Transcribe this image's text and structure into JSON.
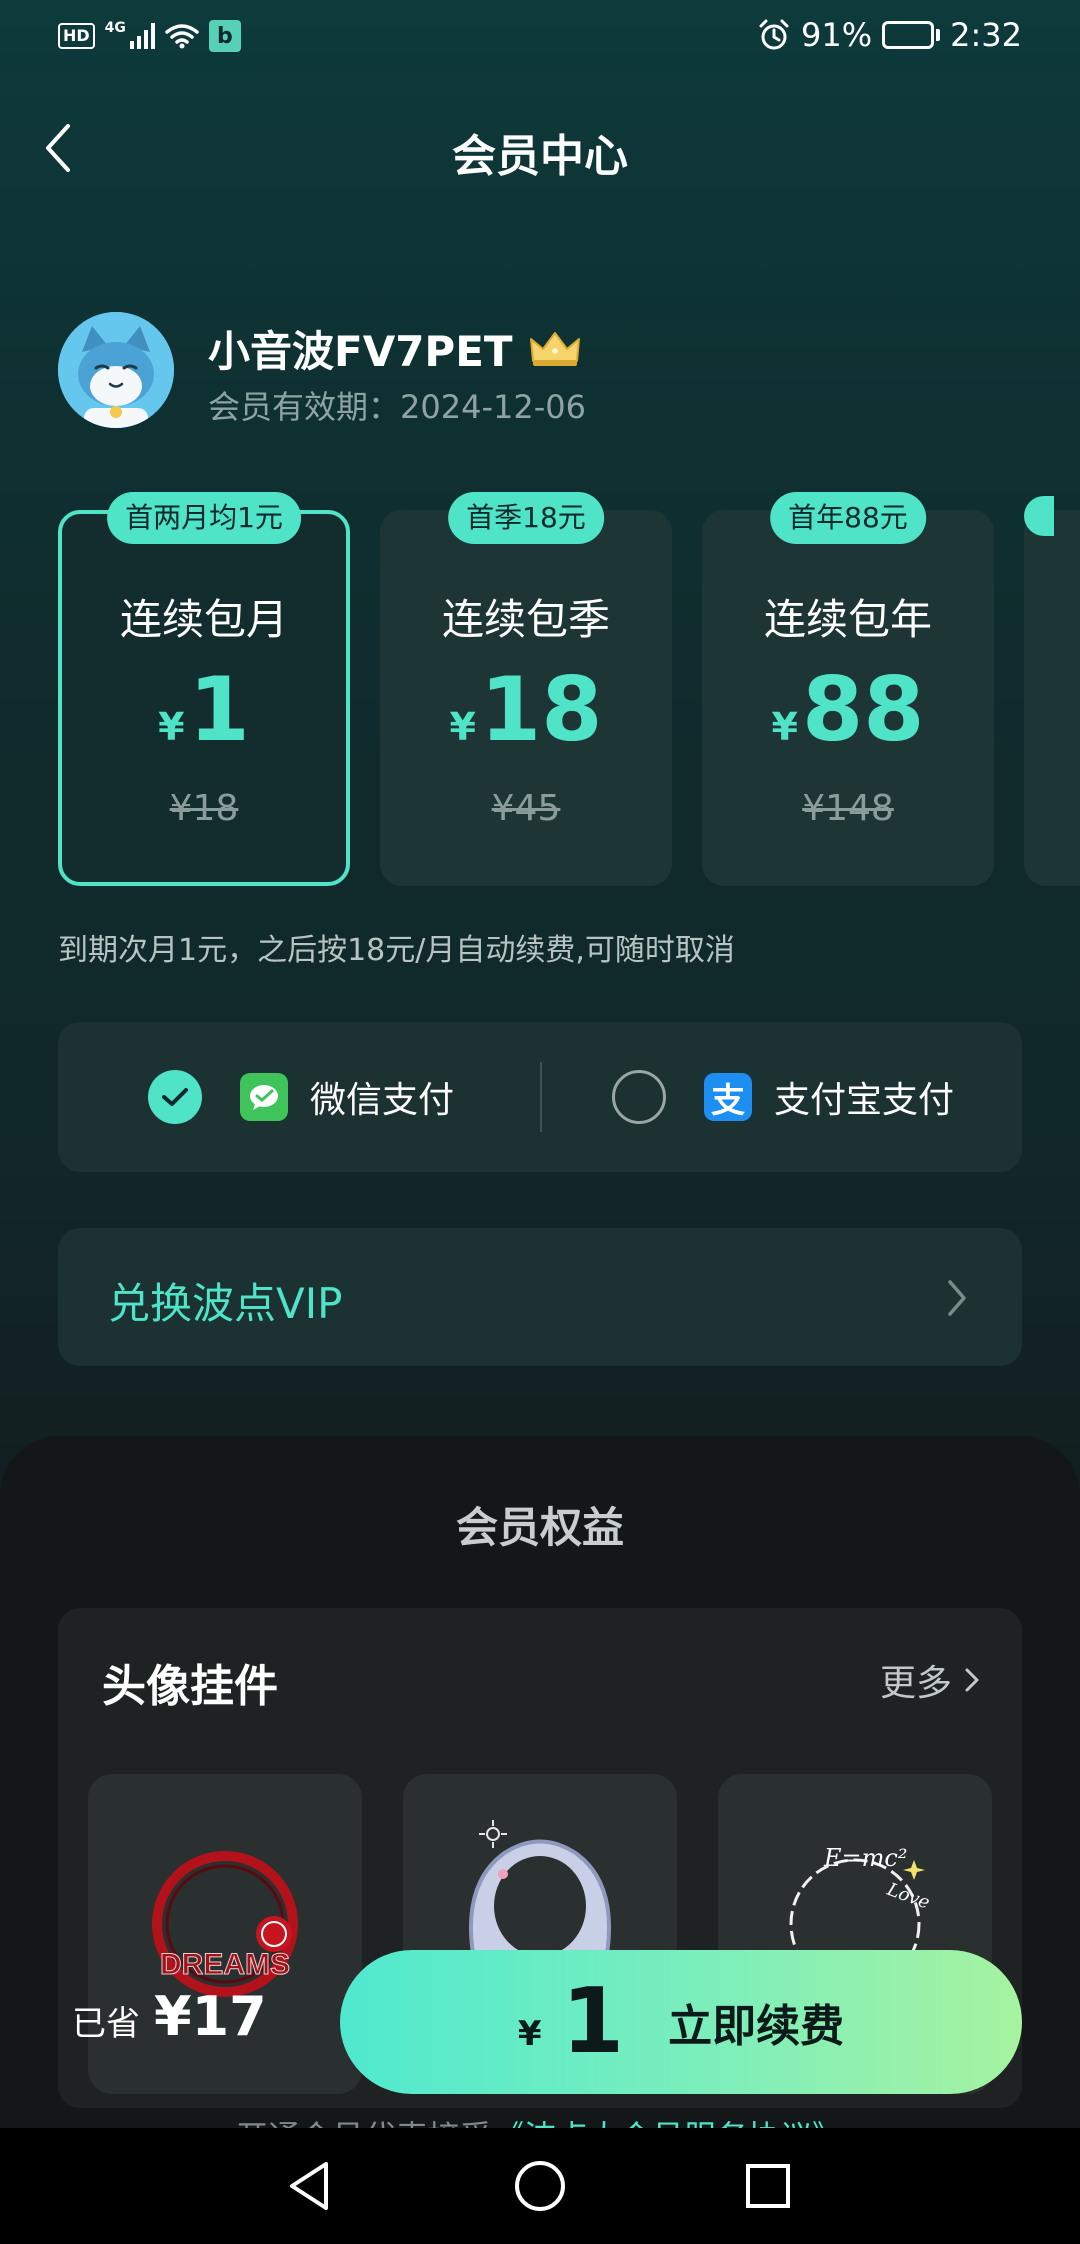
{
  "status_bar": {
    "hd": "HD",
    "network": "4G",
    "app_badge": "b",
    "battery": "91%",
    "time": "2:32"
  },
  "header": {
    "title": "会员中心"
  },
  "user": {
    "name": "小音波FV7PET",
    "expiry": "会员有效期：2024-12-06"
  },
  "plans": [
    {
      "tag": "首两月均1元",
      "name": "连续包月",
      "currency": "¥",
      "price": "1",
      "original": "¥18",
      "selected": true
    },
    {
      "tag": "首季18元",
      "name": "连续包季",
      "currency": "¥",
      "price": "18",
      "original": "¥45",
      "selected": false
    },
    {
      "tag": "首年88元",
      "name": "连续包年",
      "currency": "¥",
      "price": "88",
      "original": "¥148",
      "selected": false
    }
  ],
  "renew_note": "到期次月1元，之后按18元/月自动续费,可随时取消",
  "payment": {
    "wechat_label": "微信支付",
    "alipay_label": "支付宝支付",
    "alipay_icon_char": "支",
    "selected": "wechat"
  },
  "redeem": {
    "label": "兑换波点VIP"
  },
  "benefits": {
    "title": "会员权益",
    "section_title": "头像挂件",
    "more_label": "更多",
    "frame_texts": [
      "DREAMS",
      "E=mc²",
      "Love"
    ]
  },
  "checkout": {
    "saved_label": "已省",
    "saved_amount": "¥17",
    "currency": "¥",
    "price": "1",
    "button_label": "立即续费",
    "agreement_prefix": "开通会员代表接受",
    "agreement_link": "《波点大会员服务协议》"
  },
  "colors": {
    "accent": "#4fe3c8",
    "background_top": "#0d3a3b",
    "sheet": "#131718"
  }
}
